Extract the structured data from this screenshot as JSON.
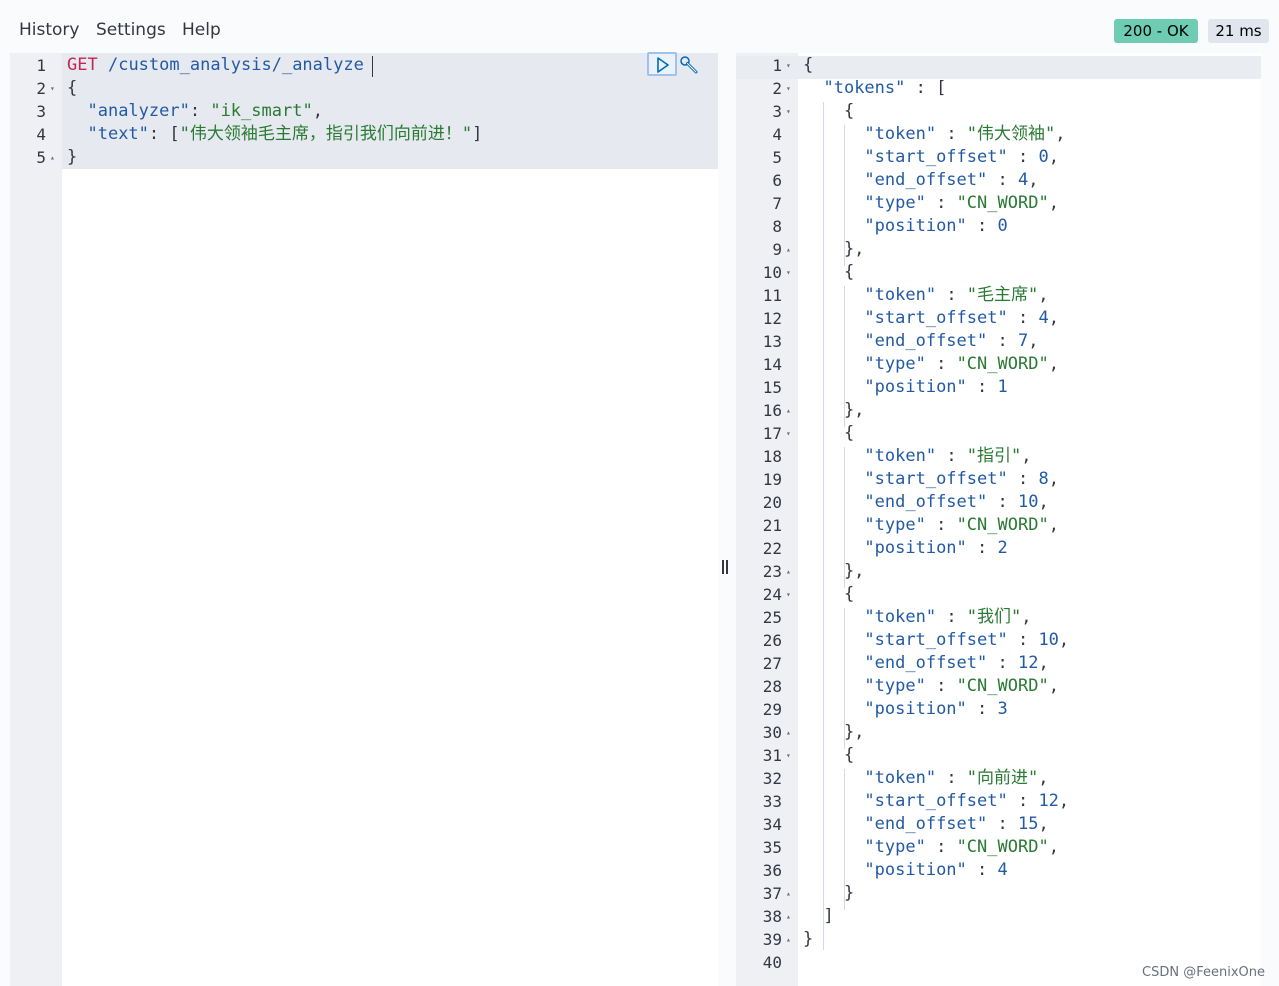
{
  "menu": {
    "history": "History",
    "settings": "Settings",
    "help": "Help"
  },
  "status": {
    "code": "200 - OK",
    "time": "21 ms"
  },
  "request": {
    "lines": [
      {
        "n": "1",
        "fold": "",
        "html": [
          {
            "t": "m",
            "v": "GET"
          },
          {
            "t": "p",
            "v": " "
          },
          {
            "t": "u",
            "v": "/custom_analysis/_analyze"
          }
        ]
      },
      {
        "n": "2",
        "fold": "▾",
        "html": [
          {
            "t": "p",
            "v": "{"
          }
        ]
      },
      {
        "n": "3",
        "fold": "",
        "html": [
          {
            "t": "p",
            "v": "  "
          },
          {
            "t": "k",
            "v": "\"analyzer\""
          },
          {
            "t": "p",
            "v": ": "
          },
          {
            "t": "s",
            "v": "\"ik_smart\""
          },
          {
            "t": "p",
            "v": ","
          }
        ]
      },
      {
        "n": "4",
        "fold": "",
        "html": [
          {
            "t": "p",
            "v": "  "
          },
          {
            "t": "k",
            "v": "\"text\""
          },
          {
            "t": "p",
            "v": ": ["
          },
          {
            "t": "s",
            "v": "\"伟大领袖毛主席，指引我们向前进！\""
          },
          {
            "t": "p",
            "v": "]"
          }
        ]
      },
      {
        "n": "5",
        "fold": "▴",
        "html": [
          {
            "t": "p",
            "v": "}"
          }
        ]
      }
    ]
  },
  "response": {
    "lines": [
      {
        "n": "1",
        "fold": "▾",
        "html": [
          {
            "t": "p",
            "v": "{"
          }
        ]
      },
      {
        "n": "2",
        "fold": "▾",
        "html": [
          {
            "t": "p",
            "v": "  "
          },
          {
            "t": "k",
            "v": "\"tokens\""
          },
          {
            "t": "p",
            "v": " : ["
          }
        ]
      },
      {
        "n": "3",
        "fold": "▾",
        "html": [
          {
            "t": "p",
            "v": "    {"
          }
        ]
      },
      {
        "n": "4",
        "fold": "",
        "html": [
          {
            "t": "p",
            "v": "      "
          },
          {
            "t": "k",
            "v": "\"token\""
          },
          {
            "t": "p",
            "v": " : "
          },
          {
            "t": "s",
            "v": "\"伟大领袖\""
          },
          {
            "t": "p",
            "v": ","
          }
        ]
      },
      {
        "n": "5",
        "fold": "",
        "html": [
          {
            "t": "p",
            "v": "      "
          },
          {
            "t": "k",
            "v": "\"start_offset\""
          },
          {
            "t": "p",
            "v": " : "
          },
          {
            "t": "n",
            "v": "0"
          },
          {
            "t": "p",
            "v": ","
          }
        ]
      },
      {
        "n": "6",
        "fold": "",
        "html": [
          {
            "t": "p",
            "v": "      "
          },
          {
            "t": "k",
            "v": "\"end_offset\""
          },
          {
            "t": "p",
            "v": " : "
          },
          {
            "t": "n",
            "v": "4"
          },
          {
            "t": "p",
            "v": ","
          }
        ]
      },
      {
        "n": "7",
        "fold": "",
        "html": [
          {
            "t": "p",
            "v": "      "
          },
          {
            "t": "k",
            "v": "\"type\""
          },
          {
            "t": "p",
            "v": " : "
          },
          {
            "t": "s",
            "v": "\"CN_WORD\""
          },
          {
            "t": "p",
            "v": ","
          }
        ]
      },
      {
        "n": "8",
        "fold": "",
        "html": [
          {
            "t": "p",
            "v": "      "
          },
          {
            "t": "k",
            "v": "\"position\""
          },
          {
            "t": "p",
            "v": " : "
          },
          {
            "t": "n",
            "v": "0"
          }
        ]
      },
      {
        "n": "9",
        "fold": "▴",
        "html": [
          {
            "t": "p",
            "v": "    },"
          }
        ]
      },
      {
        "n": "10",
        "fold": "▾",
        "html": [
          {
            "t": "p",
            "v": "    {"
          }
        ]
      },
      {
        "n": "11",
        "fold": "",
        "html": [
          {
            "t": "p",
            "v": "      "
          },
          {
            "t": "k",
            "v": "\"token\""
          },
          {
            "t": "p",
            "v": " : "
          },
          {
            "t": "s",
            "v": "\"毛主席\""
          },
          {
            "t": "p",
            "v": ","
          }
        ]
      },
      {
        "n": "12",
        "fold": "",
        "html": [
          {
            "t": "p",
            "v": "      "
          },
          {
            "t": "k",
            "v": "\"start_offset\""
          },
          {
            "t": "p",
            "v": " : "
          },
          {
            "t": "n",
            "v": "4"
          },
          {
            "t": "p",
            "v": ","
          }
        ]
      },
      {
        "n": "13",
        "fold": "",
        "html": [
          {
            "t": "p",
            "v": "      "
          },
          {
            "t": "k",
            "v": "\"end_offset\""
          },
          {
            "t": "p",
            "v": " : "
          },
          {
            "t": "n",
            "v": "7"
          },
          {
            "t": "p",
            "v": ","
          }
        ]
      },
      {
        "n": "14",
        "fold": "",
        "html": [
          {
            "t": "p",
            "v": "      "
          },
          {
            "t": "k",
            "v": "\"type\""
          },
          {
            "t": "p",
            "v": " : "
          },
          {
            "t": "s",
            "v": "\"CN_WORD\""
          },
          {
            "t": "p",
            "v": ","
          }
        ]
      },
      {
        "n": "15",
        "fold": "",
        "html": [
          {
            "t": "p",
            "v": "      "
          },
          {
            "t": "k",
            "v": "\"position\""
          },
          {
            "t": "p",
            "v": " : "
          },
          {
            "t": "n",
            "v": "1"
          }
        ]
      },
      {
        "n": "16",
        "fold": "▴",
        "html": [
          {
            "t": "p",
            "v": "    },"
          }
        ]
      },
      {
        "n": "17",
        "fold": "▾",
        "html": [
          {
            "t": "p",
            "v": "    {"
          }
        ]
      },
      {
        "n": "18",
        "fold": "",
        "html": [
          {
            "t": "p",
            "v": "      "
          },
          {
            "t": "k",
            "v": "\"token\""
          },
          {
            "t": "p",
            "v": " : "
          },
          {
            "t": "s",
            "v": "\"指引\""
          },
          {
            "t": "p",
            "v": ","
          }
        ]
      },
      {
        "n": "19",
        "fold": "",
        "html": [
          {
            "t": "p",
            "v": "      "
          },
          {
            "t": "k",
            "v": "\"start_offset\""
          },
          {
            "t": "p",
            "v": " : "
          },
          {
            "t": "n",
            "v": "8"
          },
          {
            "t": "p",
            "v": ","
          }
        ]
      },
      {
        "n": "20",
        "fold": "",
        "html": [
          {
            "t": "p",
            "v": "      "
          },
          {
            "t": "k",
            "v": "\"end_offset\""
          },
          {
            "t": "p",
            "v": " : "
          },
          {
            "t": "n",
            "v": "10"
          },
          {
            "t": "p",
            "v": ","
          }
        ]
      },
      {
        "n": "21",
        "fold": "",
        "html": [
          {
            "t": "p",
            "v": "      "
          },
          {
            "t": "k",
            "v": "\"type\""
          },
          {
            "t": "p",
            "v": " : "
          },
          {
            "t": "s",
            "v": "\"CN_WORD\""
          },
          {
            "t": "p",
            "v": ","
          }
        ]
      },
      {
        "n": "22",
        "fold": "",
        "html": [
          {
            "t": "p",
            "v": "      "
          },
          {
            "t": "k",
            "v": "\"position\""
          },
          {
            "t": "p",
            "v": " : "
          },
          {
            "t": "n",
            "v": "2"
          }
        ]
      },
      {
        "n": "23",
        "fold": "▴",
        "html": [
          {
            "t": "p",
            "v": "    },"
          }
        ]
      },
      {
        "n": "24",
        "fold": "▾",
        "html": [
          {
            "t": "p",
            "v": "    {"
          }
        ]
      },
      {
        "n": "25",
        "fold": "",
        "html": [
          {
            "t": "p",
            "v": "      "
          },
          {
            "t": "k",
            "v": "\"token\""
          },
          {
            "t": "p",
            "v": " : "
          },
          {
            "t": "s",
            "v": "\"我们\""
          },
          {
            "t": "p",
            "v": ","
          }
        ]
      },
      {
        "n": "26",
        "fold": "",
        "html": [
          {
            "t": "p",
            "v": "      "
          },
          {
            "t": "k",
            "v": "\"start_offset\""
          },
          {
            "t": "p",
            "v": " : "
          },
          {
            "t": "n",
            "v": "10"
          },
          {
            "t": "p",
            "v": ","
          }
        ]
      },
      {
        "n": "27",
        "fold": "",
        "html": [
          {
            "t": "p",
            "v": "      "
          },
          {
            "t": "k",
            "v": "\"end_offset\""
          },
          {
            "t": "p",
            "v": " : "
          },
          {
            "t": "n",
            "v": "12"
          },
          {
            "t": "p",
            "v": ","
          }
        ]
      },
      {
        "n": "28",
        "fold": "",
        "html": [
          {
            "t": "p",
            "v": "      "
          },
          {
            "t": "k",
            "v": "\"type\""
          },
          {
            "t": "p",
            "v": " : "
          },
          {
            "t": "s",
            "v": "\"CN_WORD\""
          },
          {
            "t": "p",
            "v": ","
          }
        ]
      },
      {
        "n": "29",
        "fold": "",
        "html": [
          {
            "t": "p",
            "v": "      "
          },
          {
            "t": "k",
            "v": "\"position\""
          },
          {
            "t": "p",
            "v": " : "
          },
          {
            "t": "n",
            "v": "3"
          }
        ]
      },
      {
        "n": "30",
        "fold": "▴",
        "html": [
          {
            "t": "p",
            "v": "    },"
          }
        ]
      },
      {
        "n": "31",
        "fold": "▾",
        "html": [
          {
            "t": "p",
            "v": "    {"
          }
        ]
      },
      {
        "n": "32",
        "fold": "",
        "html": [
          {
            "t": "p",
            "v": "      "
          },
          {
            "t": "k",
            "v": "\"token\""
          },
          {
            "t": "p",
            "v": " : "
          },
          {
            "t": "s",
            "v": "\"向前进\""
          },
          {
            "t": "p",
            "v": ","
          }
        ]
      },
      {
        "n": "33",
        "fold": "",
        "html": [
          {
            "t": "p",
            "v": "      "
          },
          {
            "t": "k",
            "v": "\"start_offset\""
          },
          {
            "t": "p",
            "v": " : "
          },
          {
            "t": "n",
            "v": "12"
          },
          {
            "t": "p",
            "v": ","
          }
        ]
      },
      {
        "n": "34",
        "fold": "",
        "html": [
          {
            "t": "p",
            "v": "      "
          },
          {
            "t": "k",
            "v": "\"end_offset\""
          },
          {
            "t": "p",
            "v": " : "
          },
          {
            "t": "n",
            "v": "15"
          },
          {
            "t": "p",
            "v": ","
          }
        ]
      },
      {
        "n": "35",
        "fold": "",
        "html": [
          {
            "t": "p",
            "v": "      "
          },
          {
            "t": "k",
            "v": "\"type\""
          },
          {
            "t": "p",
            "v": " : "
          },
          {
            "t": "s",
            "v": "\"CN_WORD\""
          },
          {
            "t": "p",
            "v": ","
          }
        ]
      },
      {
        "n": "36",
        "fold": "",
        "html": [
          {
            "t": "p",
            "v": "      "
          },
          {
            "t": "k",
            "v": "\"position\""
          },
          {
            "t": "p",
            "v": " : "
          },
          {
            "t": "n",
            "v": "4"
          }
        ]
      },
      {
        "n": "37",
        "fold": "▴",
        "html": [
          {
            "t": "p",
            "v": "    }"
          }
        ]
      },
      {
        "n": "38",
        "fold": "▴",
        "html": [
          {
            "t": "p",
            "v": "  ]"
          }
        ]
      },
      {
        "n": "39",
        "fold": "▴",
        "html": [
          {
            "t": "p",
            "v": "}"
          }
        ]
      },
      {
        "n": "40",
        "fold": "",
        "html": []
      }
    ]
  },
  "icons": {
    "run": "play-icon",
    "wrench": "wrench-icon",
    "resizer": "pane-resizer-icon"
  },
  "watermark": "CSDN @FeenixOne",
  "colors": {
    "status_ok_bg": "#6dccb1",
    "keyword": "#225aa3",
    "string": "#2a7a34",
    "method": "#c7254e"
  }
}
